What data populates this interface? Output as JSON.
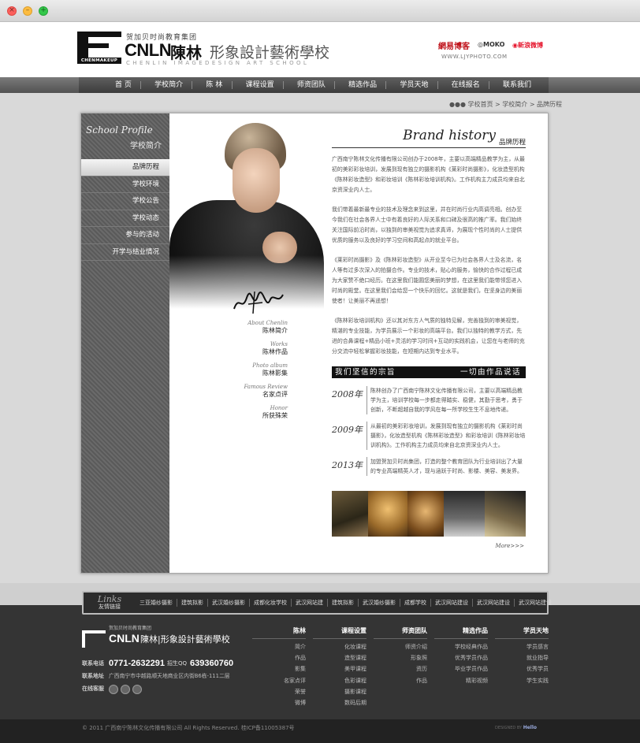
{
  "header": {
    "group_text": "贺加贝时尚教育集团",
    "cnln": "CNLN",
    "name": "陳林",
    "school": "形象設計藝術學校",
    "logo_sub": "CHENMAKEUP",
    "en_name": "CHENLIN IMAGEDESIGN ART SCHOOL",
    "partners": {
      "netease": "網易博客",
      "moko": "MOKO",
      "weibo": "新浪微博",
      "url": "WWW.LJYPHOTO.COM"
    }
  },
  "nav": [
    "首 页",
    "学校简介",
    "陈 林",
    "课程设置",
    "师资团队",
    "精选作品",
    "学员天地",
    "在线报名",
    "联系我们"
  ],
  "breadcrumb": "学校首页 > 学校简介 > 品牌历程",
  "sidebar": {
    "title_en": "School Profile",
    "title_cn": "学校简介",
    "items": [
      {
        "label": "品牌历程",
        "active": true
      },
      {
        "label": "学校环境"
      },
      {
        "label": "学校公告"
      },
      {
        "label": "学校动态"
      },
      {
        "label": "参与的活动"
      },
      {
        "label": "开学与结业情况"
      }
    ]
  },
  "side_links": [
    {
      "en": "About Chenlin",
      "cn": "陈林简介"
    },
    {
      "en": "Works",
      "cn": "陈林作品"
    },
    {
      "en": "Photo album",
      "cn": "陈林影集"
    },
    {
      "en": "Famous Review",
      "cn": "名家点评"
    },
    {
      "en": "Honor",
      "cn": "所获殊荣"
    }
  ],
  "main": {
    "title_en": "Brand history",
    "title_cn": "品牌历程",
    "paragraphs": [
      "广西南宁陈林文化传播有限公司创办于2008年，主要以高端精品教学为主，从最初的美彩彩妆培训，发展到现有独立的摄影机构《莱彩时尚摄影》，化妆造型机构《陈林彩妆造型》和彩妆培训《陈林彩妆培训机构》。工作机构主力成员均来自北京资深业内人士。",
      "我们带着最新最专业的技术及理念来到这里，并在时尚行业内高调亮相。创办至今我们在社会各界人士中有着良好的人际关系和口碑及很高的推广率。我们始终关注国际前沿时尚，以独到的审美视觉为追求真谛，为展现个性时尚的人士提供优质的服务以及良好的学习空间和高起点的就业平台。",
      "《莱彩时尚摄影》及《陈林彩妆造型》从开业至今已为社会各界人士及名流，名人等有过多次深入的拍摄合作。专业的技术，贴心的服务，愉快的合作过程已成为大家赞不绝口经历。在这里我们能圆您美丽的梦想，在这里我们能带领您进入时尚的殿堂。在这里我们会给您一个快乐的回忆。这就是我们，在坚身边的美丽使者！让美丽不再遥想！",
      "《陈林彩妆培训机构》还以其对东方人气质的独特见解，完善独到的审美视觉，精湛的专业技能，为学员展示一个彩妆的高端平台。我们以独特的教学方式，先进的合鼻课程+精品小班+灵活的学习时间+互动的实践机会，让您在与老师的充分交流中轻松掌握彩妆技能，在短期内达到专业水平。"
    ],
    "slogan_left": "我们坚信的宗旨",
    "slogan_right": "一切由作品说话",
    "timeline": [
      {
        "year": "2008年",
        "text": "陈林创办了广西南宁陈林文化传播有限公司，主要以高端精品教学为主，培训学校每一步都走得踏实、稳健，其勤于思考，勇于创新，不断超越自我的学风在每一所学校生生不息地传递。"
      },
      {
        "year": "2009年",
        "text": "从最初的美彩彩妆培训，发展到现有独立的摄影机构《莱彩时尚摄影》，化妆造型机构《陈林彩妆造型》和彩妆培训《陈林彩妆培训机构》。工作机构主力成员均来自北京资深业内人士。"
      },
      {
        "year": "2013年",
        "text": "加盟贺加贝时尚集团，打造的整个教育团队为行业培训出了大量的专业高端精英人才，现与涵跃于时尚、影楼、美容、美发界。"
      }
    ],
    "more": "More>>>"
  },
  "links": {
    "title_en": "Links",
    "title_cn": "友情链接",
    "items": [
      "三亚婚纱摄影",
      "建筑拟影",
      "武汉婚纱摄影",
      "成都化妆学校",
      "武汉网站建",
      "建筑拟影",
      "武汉婚纱摄影",
      "成都学校",
      "武汉网站建设",
      "武汉网站建设",
      "武汉网站建设"
    ]
  },
  "footer": {
    "group": "贺加贝时尚教育集团",
    "cnln": "CNLN",
    "name": "陳林|形象設計藝術學校",
    "phone_label": "联系电话",
    "phone": "0771-2632291",
    "qq_label": "招生QQ",
    "qq": "639360760",
    "address_label": "联系地址",
    "address": "广西南宁市中越路顺天地商业区内街B6栋-111二层",
    "service_label": "在线客服",
    "columns": [
      {
        "title": "陈林",
        "items": [
          "简介",
          "作品",
          "影集",
          "名家点评",
          "荣誉",
          "微博"
        ]
      },
      {
        "title": "课程设置",
        "items": [
          "化妆课程",
          "造型课程",
          "美甲课程",
          "色彩课程",
          "摄影课程",
          "数码后期"
        ]
      },
      {
        "title": "师资团队",
        "items": [
          "师资介绍",
          "形象照",
          "资历",
          "作品"
        ]
      },
      {
        "title": "精选作品",
        "items": [
          "学校经典作品",
          "优秀学员作品",
          "毕业学员作品",
          "精彩视频"
        ]
      },
      {
        "title": "学员天地",
        "items": [
          "学员感言",
          "就业指导",
          "优秀学员",
          "学生实践"
        ]
      }
    ],
    "copyright": "© 2011 广西南宁陈林文化传播有限公司 All Rights Reserved. 桂ICP备11005387号",
    "powered": "DESIGNED BY",
    "powered_brand": "Hello"
  }
}
